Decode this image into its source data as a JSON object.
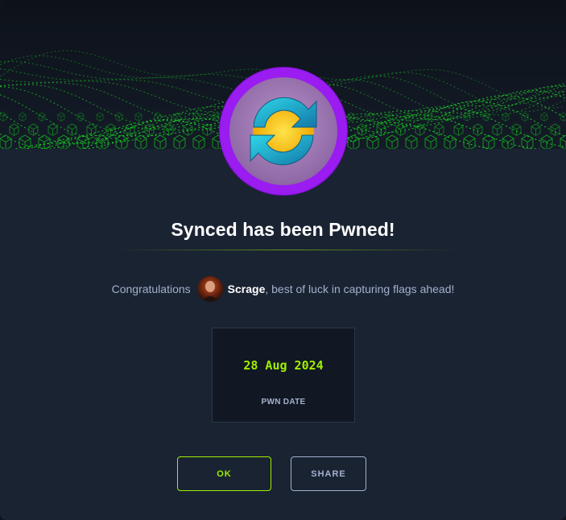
{
  "modal": {
    "title": "Synced has been Pwned!",
    "machine_icon": "sync-arrows-icon",
    "congrats": {
      "prefix": "Congratulations",
      "username": "Scrage",
      "suffix": ", best of luck in capturing flags ahead!"
    },
    "pwn_date": {
      "value": "28 Aug 2024",
      "label": "PWN DATE"
    },
    "buttons": {
      "ok_label": "OK",
      "share_label": "SHARE"
    }
  },
  "colors": {
    "background": "#1a2332",
    "accent_green": "#9fef00",
    "ring_purple": "#9a1cf0",
    "muted_text": "#a4b1cd"
  }
}
